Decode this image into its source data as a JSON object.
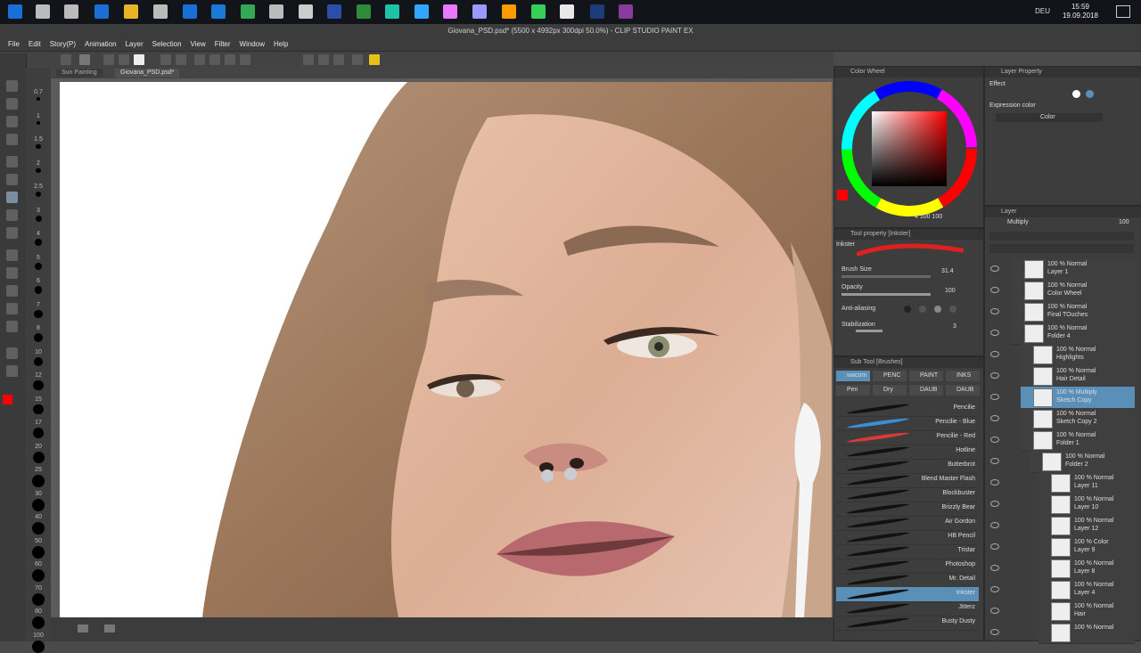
{
  "taskbar": {
    "clock_time": "15:59",
    "clock_date": "19.09.2018",
    "language": "DEU",
    "icons": [
      "windows-start-icon",
      "search-icon",
      "task-view-icon",
      "store-icon",
      "explorer-icon",
      "mail-icon",
      "shop-icon",
      "edge-icon",
      "chrome-icon",
      "pen-icon",
      "clock-app-icon",
      "shield-app-icon",
      "vpn-icon",
      "audition-icon",
      "photoshop-icon",
      "premiere-icon",
      "after-effects-icon",
      "illustrator-icon",
      "speedgrade-icon",
      "clip-studio-icon",
      "kodi-icon",
      "onenote-icon"
    ]
  },
  "window": {
    "title": "Giovana_PSD.psd* (5500 x 4992px 300dpi 50.0%)  - CLIP STUDIO PAINT EX"
  },
  "menu": [
    "File",
    "Edit",
    "Story(P)",
    "Animation",
    "Layer",
    "Selection",
    "View",
    "Filter",
    "Window",
    "Help"
  ],
  "canvas_tabs": [
    "Sun Painting",
    "Giovana_PSD.psd*"
  ],
  "brush_sizes": [
    "0.7",
    "1",
    "1.5",
    "2",
    "2.5",
    "3",
    "4",
    "5",
    "6",
    "7",
    "8",
    "10",
    "12",
    "15",
    "17",
    "20",
    "25",
    "30",
    "40",
    "50",
    "60",
    "70",
    "80",
    "100"
  ],
  "colors": {
    "main": "#ff0000",
    "sub": "#000000",
    "ui_accent": "#5a8fb8"
  },
  "color_wheel": {
    "title": "Color Wheel",
    "readout": "4  100  100"
  },
  "layer_property": {
    "title": "Layer Property",
    "effect_label": "Effect",
    "expression_color_label": "Expression color",
    "expression_color_value": "Color"
  },
  "tool_property": {
    "title": "Tool property [Inkster]",
    "brush_name": "Inkster",
    "brush_size_label": "Brush Size",
    "brush_size_value": "31.4",
    "opacity_label": "Opacity",
    "opacity_value": "100",
    "antialiasing_label": "Anti-aliasing",
    "stabilization_label": "Stabilization",
    "stabilization_value": "3"
  },
  "sub_tool": {
    "title": "Sub Tool [Brushes]",
    "tabs_row1": [
      "wacom",
      "PENC",
      "PAINT",
      "INKS"
    ],
    "tabs_row2": [
      "Pen",
      "Dry",
      "DAUB",
      "DAUB"
    ],
    "brushes": [
      "Pencilie",
      "Pencilie - Blue",
      "Pencilie - Red",
      "Hotline",
      "Butterbrot",
      "Blend Master Flash",
      "Blockbuster",
      "Brizzly Bear",
      "Air Gordon",
      "HB Pencil",
      "Tristar",
      "Photoshop",
      "Mr. Detail",
      "Inkster",
      "Jitterz",
      "Busty Dusty"
    ],
    "selected": "Inkster"
  },
  "layers": {
    "title": "Layer",
    "blend_mode": "Multiply",
    "opacity": "100",
    "items": [
      {
        "mode": "100 % Normal",
        "name": "Layer 1",
        "indent": 0,
        "selected": false
      },
      {
        "mode": "100 % Normal",
        "name": "Color Wheel",
        "indent": 0,
        "selected": false
      },
      {
        "mode": "100 % Normal",
        "name": "Final TOuches",
        "indent": 0,
        "selected": false
      },
      {
        "mode": "100 % Normal",
        "name": "Folder 4",
        "indent": 0,
        "selected": false
      },
      {
        "mode": "100 % Normal",
        "name": "Highlights",
        "indent": 1,
        "selected": false
      },
      {
        "mode": "100 % Normal",
        "name": "Hair Detail",
        "indent": 1,
        "selected": false
      },
      {
        "mode": "100 % Multiply",
        "name": "Sketch Copy",
        "indent": 1,
        "selected": true
      },
      {
        "mode": "100 % Normal",
        "name": "Sketch Copy 2",
        "indent": 1,
        "selected": false
      },
      {
        "mode": "100 % Normal",
        "name": "Folder 1",
        "indent": 1,
        "selected": false
      },
      {
        "mode": "100 % Normal",
        "name": "Folder 2",
        "indent": 2,
        "selected": false
      },
      {
        "mode": "100 % Normal",
        "name": "Layer 11",
        "indent": 3,
        "selected": false
      },
      {
        "mode": "100 % Normal",
        "name": "Layer 10",
        "indent": 3,
        "selected": false
      },
      {
        "mode": "100 % Normal",
        "name": "Layer 12",
        "indent": 3,
        "selected": false
      },
      {
        "mode": "100 % Color",
        "name": "Layer 9",
        "indent": 3,
        "selected": false
      },
      {
        "mode": "100 % Normal",
        "name": "Layer 8",
        "indent": 3,
        "selected": false
      },
      {
        "mode": "100 % Normal",
        "name": "Layer 4",
        "indent": 3,
        "selected": false
      },
      {
        "mode": "100 % Normal",
        "name": "Hair",
        "indent": 3,
        "selected": false
      },
      {
        "mode": "100 % Normal",
        "name": "",
        "indent": 3,
        "selected": false
      }
    ]
  }
}
